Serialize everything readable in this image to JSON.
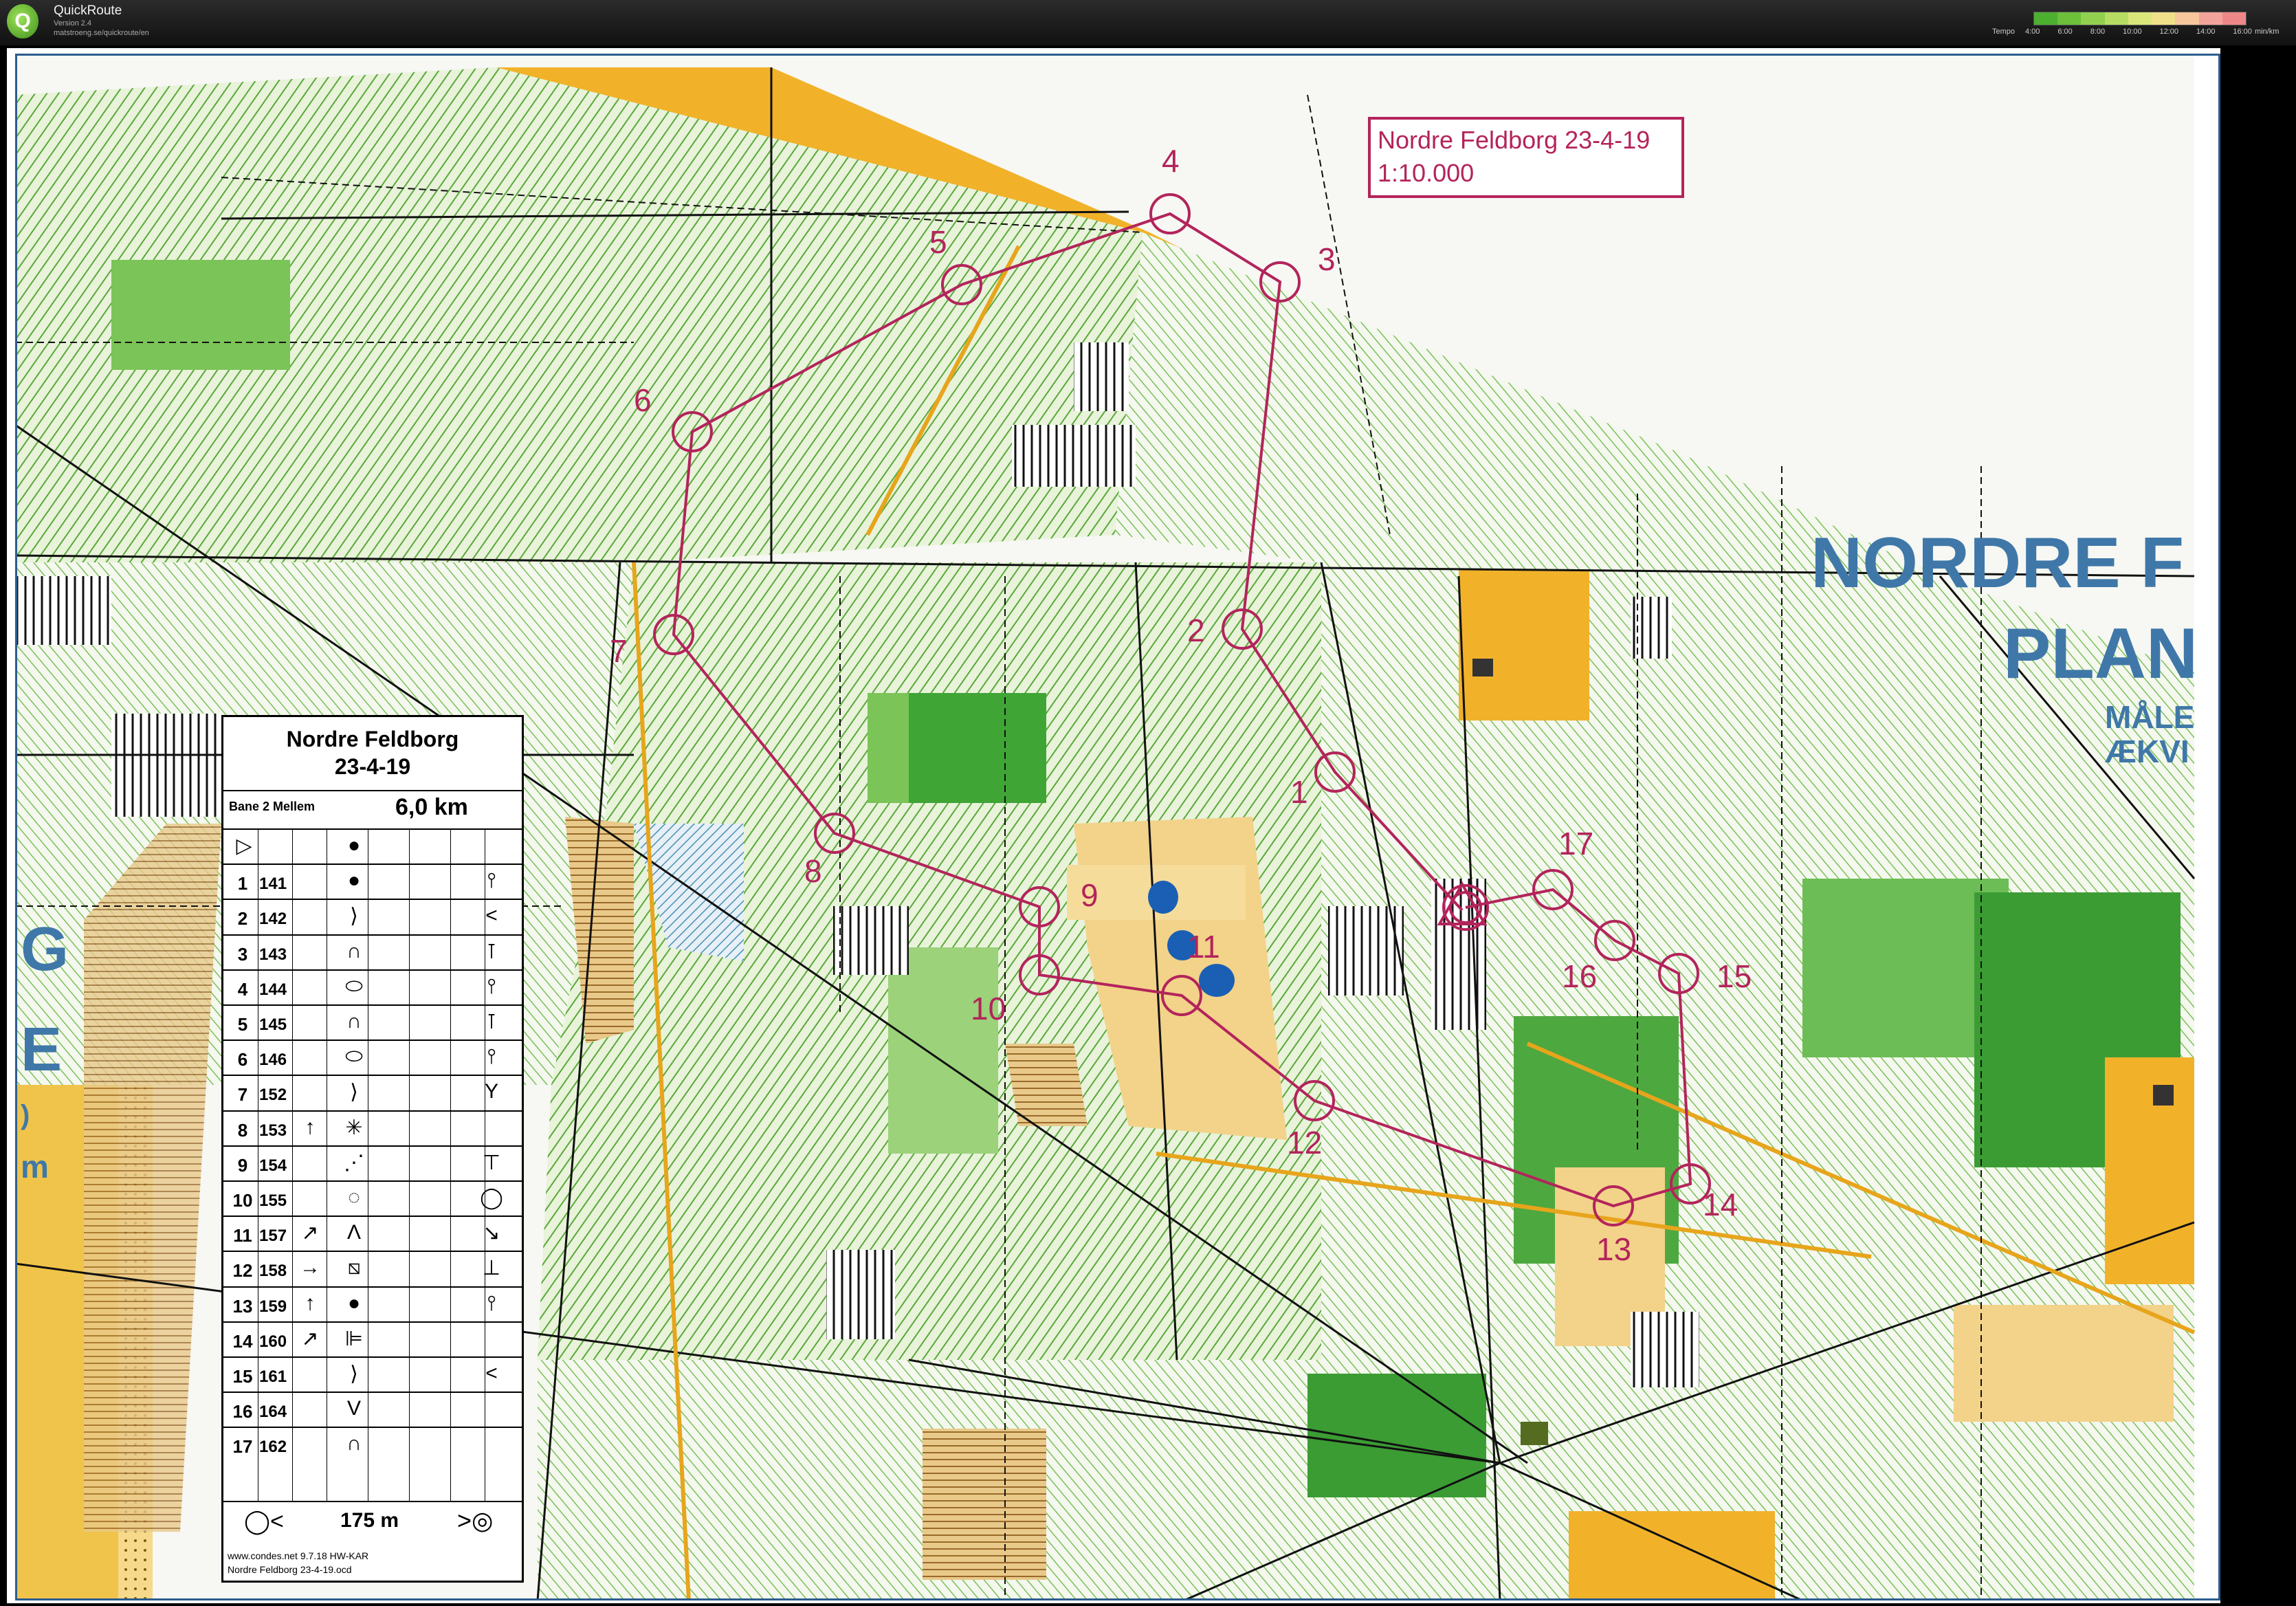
{
  "app": {
    "name": "QuickRoute",
    "version": "Version 2.4",
    "url": "matstroeng.se/quickroute/en",
    "logo_letter": "Q"
  },
  "tempo": {
    "label": "Tempo",
    "ticks": [
      "4:00",
      "6:00",
      "8:00",
      "10:00",
      "12:00",
      "14:00",
      "16:00"
    ],
    "unit": "min/km",
    "colors": [
      "#4caf30",
      "#6cc03a",
      "#92d050",
      "#b7dd62",
      "#d9e77a",
      "#f1e08a",
      "#f5c79a",
      "#f2a39b",
      "#ee8888"
    ]
  },
  "map_title": {
    "line1": "Nordre Feldborg 23-4-19",
    "line2": "1:10.000"
  },
  "map_labels": {
    "nordre": "NORDRE F",
    "plan": "PLAN",
    "male": "MÅLE",
    "aekvi": "ÆKVI",
    "g": "G",
    "e": "E",
    "zero": ")",
    "m": "m"
  },
  "course": {
    "colors": {
      "overprint": "#b3245b",
      "water": "#1a5fb4"
    },
    "controls": [
      {
        "label": "1"
      },
      {
        "label": "2"
      },
      {
        "label": "3"
      },
      {
        "label": "4"
      },
      {
        "label": "5"
      },
      {
        "label": "6"
      },
      {
        "label": "7"
      },
      {
        "label": "8"
      },
      {
        "label": "9"
      },
      {
        "label": "10"
      },
      {
        "label": "11"
      },
      {
        "label": "12"
      },
      {
        "label": "13"
      },
      {
        "label": "14"
      },
      {
        "label": "15"
      },
      {
        "label": "16"
      },
      {
        "label": "17"
      }
    ]
  },
  "legend": {
    "title": "Nordre Feldborg\n23-4-19",
    "course": "Bane 2 Mellem",
    "length": "6,0 km",
    "rows": [
      {
        "num": "",
        "code": "",
        "dir": "",
        "feature": "●",
        "detail": ""
      },
      {
        "num": "1",
        "code": "141",
        "dir": "",
        "feature": "●",
        "detail": "⫯"
      },
      {
        "num": "2",
        "code": "142",
        "dir": "",
        "feature": "⟩",
        "detail": "<"
      },
      {
        "num": "3",
        "code": "143",
        "dir": "",
        "feature": "∩",
        "detail": "⊺"
      },
      {
        "num": "4",
        "code": "144",
        "dir": "",
        "feature": "⬭",
        "detail": "⫯"
      },
      {
        "num": "5",
        "code": "145",
        "dir": "",
        "feature": "∩",
        "detail": "⊺"
      },
      {
        "num": "6",
        "code": "146",
        "dir": "",
        "feature": "⬭",
        "detail": "⫯"
      },
      {
        "num": "7",
        "code": "152",
        "dir": "",
        "feature": "⟩",
        "detail": "Y"
      },
      {
        "num": "8",
        "code": "153",
        "dir": "↑",
        "feature": "✳",
        "detail": ""
      },
      {
        "num": "9",
        "code": "154",
        "dir": "",
        "feature": "⋰",
        "detail": "⊤"
      },
      {
        "num": "10",
        "code": "155",
        "dir": "",
        "feature": "◌",
        "detail": "◯"
      },
      {
        "num": "11",
        "code": "157",
        "dir": "↗",
        "feature": "Λ",
        "detail": "↘"
      },
      {
        "num": "12",
        "code": "158",
        "dir": "→",
        "feature": "⧅",
        "detail": "⊥"
      },
      {
        "num": "13",
        "code": "159",
        "dir": "↑",
        "feature": "●",
        "detail": "⫯"
      },
      {
        "num": "14",
        "code": "160",
        "dir": "↗",
        "feature": "⊫",
        "detail": ""
      },
      {
        "num": "15",
        "code": "161",
        "dir": "",
        "feature": "⟩",
        "detail": "<"
      },
      {
        "num": "16",
        "code": "164",
        "dir": "",
        "feature": "V",
        "detail": ""
      },
      {
        "num": "17",
        "code": "162",
        "dir": "",
        "feature": "∩",
        "detail": ""
      }
    ],
    "finish_text": "175 m",
    "credit1": "www.condes.net 9.7.18 HW-KAR",
    "credit2": "Nordre Feldborg 23-4-19.ocd"
  }
}
